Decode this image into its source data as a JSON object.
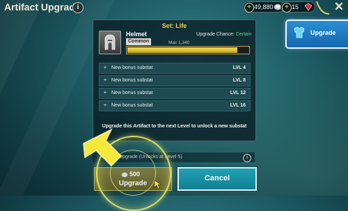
{
  "header": {
    "title": "Artifact Upgrade",
    "info_icon": "info-icon",
    "silver": "49,880",
    "gems": "15",
    "close_icon": "close-icon"
  },
  "side_tab": {
    "label": "Upgrade",
    "icon": "armor-icon"
  },
  "panel": {
    "set_title": "Set: Life",
    "artifact": {
      "name": "Helmet",
      "rarity": "Common",
      "chance_label": "Upgrade Chance:",
      "chance_value": "Certain",
      "max_label": "Max 1,340",
      "xp_fraction": 0.91
    },
    "substats": [
      {
        "label": "New bonus substat",
        "level": "LVL 4"
      },
      {
        "label": "New bonus substat",
        "level": "LVL 8"
      },
      {
        "label": "New bonus substat",
        "level": "LVL 12"
      },
      {
        "label": "New bonus substat",
        "level": "LVL 16"
      }
    ],
    "unlock_text": "Upgrade this Artifact to the next Level to unlock a new substat"
  },
  "bottom": {
    "upgrade_info": "Upgrade (Unlocks at Level 5)",
    "upgrade_cost": "500",
    "upgrade_label": "Upgrade",
    "cancel_label": "Cancel"
  },
  "colors": {
    "set_title": "#f2d14d",
    "chance_value": "#76d09c",
    "side_tab": "#1f7bc4",
    "cancel_button": "#1a93a6",
    "highlight": "#e8eb78"
  }
}
